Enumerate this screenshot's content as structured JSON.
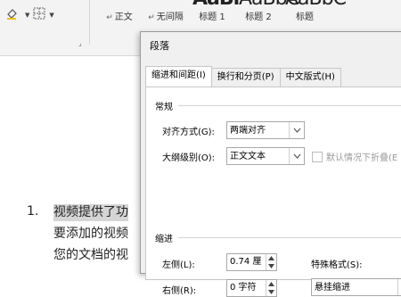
{
  "ribbon": {
    "styles": [
      {
        "mark": "↵",
        "label": "正文"
      },
      {
        "mark": "↵",
        "label": "无间隔"
      },
      {
        "big": "AaBl",
        "label": "标题 1"
      },
      {
        "big": "AaBbC",
        "label": "标题 2"
      },
      {
        "big": "AaBbC",
        "label": "标题"
      }
    ]
  },
  "document": {
    "list_number": "1.",
    "lines": [
      "视频提供了功",
      "要添加的视频",
      "您的文档的视"
    ]
  },
  "dialog": {
    "title": "段落",
    "tabs": [
      "缩进和间距(I)",
      "换行和分页(P)",
      "中文版式(H)"
    ],
    "general": {
      "section_label": "常规",
      "alignment_label": "对齐方式(G):",
      "alignment_value": "两端对齐",
      "outline_label": "大纲级别(O):",
      "outline_value": "正文文本",
      "collapse_label": "默认情况下折叠(E"
    },
    "indent": {
      "section_label": "缩进",
      "left_label": "左侧(L):",
      "left_value": "0.74 厘",
      "right_label": "右侧(R):",
      "right_value": "0 字符",
      "special_label": "特殊格式(S):",
      "special_value": "悬挂缩进"
    }
  }
}
